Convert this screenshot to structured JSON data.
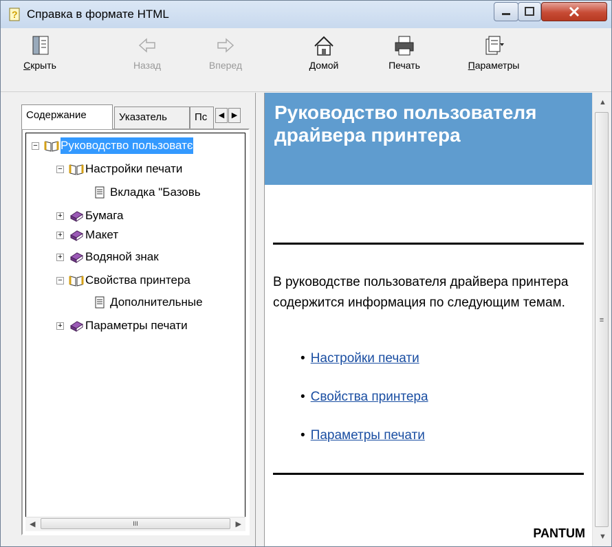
{
  "window": {
    "title": "Справка в формате HTML",
    "buttons": {
      "minimize": "–",
      "maximize": "□",
      "close": "X"
    }
  },
  "toolbar": {
    "hide_label": "Скрыть",
    "back_label": "Назад",
    "forward_label": "Вперед",
    "home_label": "Домой",
    "print_label": "Печать",
    "options_label": "Параметры"
  },
  "nav": {
    "tabs": [
      "Содержание",
      "Указатель",
      "Пс"
    ],
    "tree": [
      {
        "label": "Руководство пользоватє",
        "expander": "−",
        "icon": "open-book-icon",
        "selected": true
      },
      {
        "label": "Настройки печати",
        "expander": "−",
        "icon": "open-book-icon"
      },
      {
        "label": "Вкладка \"Базовь",
        "icon": "page-icon"
      },
      {
        "label": "Бумага",
        "expander": "+",
        "icon": "closed-book-icon"
      },
      {
        "label": "Макет",
        "expander": "+",
        "icon": "closed-book-icon"
      },
      {
        "label": "Водяной знак",
        "expander": "+",
        "icon": "closed-book-icon"
      },
      {
        "label": "Свойства принтера",
        "expander": "−",
        "icon": "open-book-icon"
      },
      {
        "label": "Дополнительные",
        "icon": "page-icon"
      },
      {
        "label": "Параметры печати",
        "expander": "+",
        "icon": "closed-book-icon"
      }
    ],
    "hscroll_grip": "III"
  },
  "content": {
    "heading": "Руководство пользователя драйвера принтера",
    "intro": "В руководстве пользователя драйвера принтера содержится информация по следующим темам.",
    "topics": [
      "Настройки печати",
      "Свойства принтера",
      "Параметры печати"
    ],
    "brand": "PANTUM",
    "vscroll_grip": "≡"
  },
  "colors": {
    "heading_bg": "#5f9ccf",
    "link": "#1a4ea2",
    "selection": "#3399ff",
    "close_button": "#c74b35"
  }
}
